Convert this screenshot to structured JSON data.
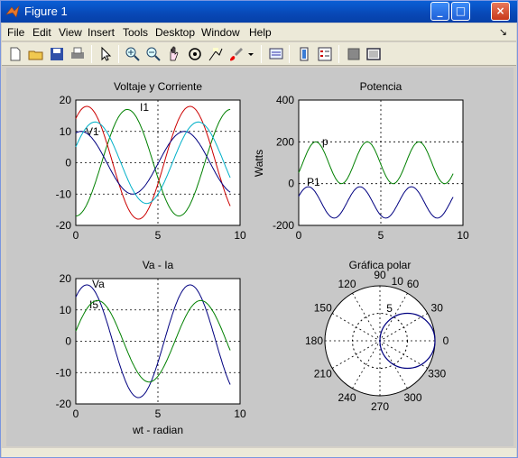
{
  "window": {
    "title": "Figure 1",
    "accent": "#0848b6"
  },
  "window_buttons": {
    "minimize": "_",
    "maximize": "□",
    "close": "×"
  },
  "menu": [
    "File",
    "Edit",
    "View",
    "Insert",
    "Tools",
    "Desktop",
    "Window",
    "Help"
  ],
  "menu_arrow": "↘",
  "toolbar_icons": [
    "new-figure-icon",
    "open-icon",
    "save-icon",
    "print-icon",
    "pointer-icon",
    "zoom-in-icon",
    "zoom-out-icon",
    "pan-icon",
    "rotate-icon",
    "data-cursor-icon",
    "brush-icon",
    "brush-dropdown-icon",
    "link-icon",
    "colorbar-icon",
    "legend-icon",
    "hide-plot-tools-icon",
    "show-plot-tools-icon"
  ],
  "chart_data": [
    {
      "type": "line",
      "title": "Voltaje y Corriente",
      "xlabel": "",
      "ylabel": "",
      "xlim": [
        0,
        10
      ],
      "ylim": [
        -20,
        20
      ],
      "xticks": [
        "0",
        "5",
        "10"
      ],
      "yticks": [
        "20",
        "10",
        "0",
        "-10",
        "-20"
      ],
      "grid": "dashed",
      "annotations": [
        "I1",
        "V1"
      ],
      "series": [
        {
          "color": "#008000",
          "amplitude": 17,
          "phase": -1.5708,
          "x_end": 9.4
        },
        {
          "color": "#cc0000",
          "amplitude": 18,
          "phase": 0.9,
          "x_end": 9.4
        },
        {
          "color": "#000080",
          "amplitude": 10,
          "phase": 1.25,
          "x_end": 9.4
        },
        {
          "color": "#00b0c8",
          "amplitude": 13,
          "phase": 0.4,
          "x_end": 9.4
        }
      ]
    },
    {
      "type": "line",
      "title": "Potencia",
      "xlabel": "",
      "ylabel": "Watts",
      "xlim": [
        0,
        10
      ],
      "ylim": [
        -200,
        400
      ],
      "xticks": [
        "0",
        "5",
        "10"
      ],
      "yticks": [
        "400",
        "200",
        "0",
        "-200"
      ],
      "grid": "dashed",
      "annotations": [
        "p",
        "P1"
      ],
      "series": [
        {
          "color": "#008000",
          "offset": 100,
          "amplitude": 100,
          "phase": -0.5,
          "x_end": 9.4
        },
        {
          "color": "#000080",
          "offset": -90,
          "amplitude": 75,
          "phase": 0.4,
          "x_end": 9.4
        }
      ]
    },
    {
      "type": "line",
      "title": "Va - Ia",
      "xlabel": "wt - radian",
      "ylabel": "",
      "xlim": [
        0,
        10
      ],
      "ylim": [
        -20,
        20
      ],
      "xticks": [
        "0",
        "5",
        "10"
      ],
      "yticks": [
        "20",
        "10",
        "0",
        "-10",
        "-20"
      ],
      "grid": "dashed",
      "annotations": [
        "Va",
        "I5"
      ],
      "series": [
        {
          "color": "#000080",
          "amplitude": 18,
          "phase": 0.9,
          "x_end": 9.4
        },
        {
          "color": "#008000",
          "amplitude": 13,
          "phase": 0.25,
          "x_end": 9.4
        }
      ]
    },
    {
      "type": "polar",
      "title": "Gráfica polar",
      "angle_labels": [
        "90",
        "60",
        "30",
        "0",
        "330",
        "300",
        "270",
        "240",
        "210",
        "180",
        "150",
        "120"
      ],
      "radius_labels": [
        "5",
        "10"
      ],
      "rmax": 10,
      "series": [
        {
          "color": "#000080",
          "shape": "circle",
          "diameter": 10,
          "center_angle": 0
        }
      ]
    }
  ]
}
